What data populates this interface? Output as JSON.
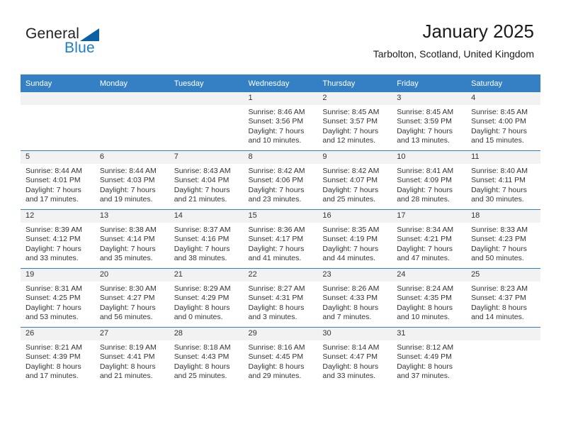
{
  "logo": {
    "word1": "General",
    "word2": "Blue",
    "accent_color": "#1d7ec8",
    "triangle_color": "#0b5fa5"
  },
  "header": {
    "title": "January 2025",
    "subtitle": "Tarbolton, Scotland, United Kingdom"
  },
  "theme": {
    "header_bg": "#3580c4",
    "daynum_bg": "#f2f2f2",
    "text": "#333333"
  },
  "weekday_headers": [
    "Sunday",
    "Monday",
    "Tuesday",
    "Wednesday",
    "Thursday",
    "Friday",
    "Saturday"
  ],
  "weeks": [
    [
      {
        "day": "",
        "empty": true,
        "sunrise": "",
        "sunset": "",
        "daylight1": "",
        "daylight2": ""
      },
      {
        "day": "",
        "empty": true,
        "sunrise": "",
        "sunset": "",
        "daylight1": "",
        "daylight2": ""
      },
      {
        "day": "",
        "empty": true,
        "sunrise": "",
        "sunset": "",
        "daylight1": "",
        "daylight2": ""
      },
      {
        "day": "1",
        "empty": false,
        "sunrise": "Sunrise: 8:46 AM",
        "sunset": "Sunset: 3:56 PM",
        "daylight1": "Daylight: 7 hours",
        "daylight2": "and 10 minutes."
      },
      {
        "day": "2",
        "empty": false,
        "sunrise": "Sunrise: 8:45 AM",
        "sunset": "Sunset: 3:57 PM",
        "daylight1": "Daylight: 7 hours",
        "daylight2": "and 12 minutes."
      },
      {
        "day": "3",
        "empty": false,
        "sunrise": "Sunrise: 8:45 AM",
        "sunset": "Sunset: 3:59 PM",
        "daylight1": "Daylight: 7 hours",
        "daylight2": "and 13 minutes."
      },
      {
        "day": "4",
        "empty": false,
        "sunrise": "Sunrise: 8:45 AM",
        "sunset": "Sunset: 4:00 PM",
        "daylight1": "Daylight: 7 hours",
        "daylight2": "and 15 minutes."
      }
    ],
    [
      {
        "day": "5",
        "empty": false,
        "sunrise": "Sunrise: 8:44 AM",
        "sunset": "Sunset: 4:01 PM",
        "daylight1": "Daylight: 7 hours",
        "daylight2": "and 17 minutes."
      },
      {
        "day": "6",
        "empty": false,
        "sunrise": "Sunrise: 8:44 AM",
        "sunset": "Sunset: 4:03 PM",
        "daylight1": "Daylight: 7 hours",
        "daylight2": "and 19 minutes."
      },
      {
        "day": "7",
        "empty": false,
        "sunrise": "Sunrise: 8:43 AM",
        "sunset": "Sunset: 4:04 PM",
        "daylight1": "Daylight: 7 hours",
        "daylight2": "and 21 minutes."
      },
      {
        "day": "8",
        "empty": false,
        "sunrise": "Sunrise: 8:42 AM",
        "sunset": "Sunset: 4:06 PM",
        "daylight1": "Daylight: 7 hours",
        "daylight2": "and 23 minutes."
      },
      {
        "day": "9",
        "empty": false,
        "sunrise": "Sunrise: 8:42 AM",
        "sunset": "Sunset: 4:07 PM",
        "daylight1": "Daylight: 7 hours",
        "daylight2": "and 25 minutes."
      },
      {
        "day": "10",
        "empty": false,
        "sunrise": "Sunrise: 8:41 AM",
        "sunset": "Sunset: 4:09 PM",
        "daylight1": "Daylight: 7 hours",
        "daylight2": "and 28 minutes."
      },
      {
        "day": "11",
        "empty": false,
        "sunrise": "Sunrise: 8:40 AM",
        "sunset": "Sunset: 4:11 PM",
        "daylight1": "Daylight: 7 hours",
        "daylight2": "and 30 minutes."
      }
    ],
    [
      {
        "day": "12",
        "empty": false,
        "sunrise": "Sunrise: 8:39 AM",
        "sunset": "Sunset: 4:12 PM",
        "daylight1": "Daylight: 7 hours",
        "daylight2": "and 33 minutes."
      },
      {
        "day": "13",
        "empty": false,
        "sunrise": "Sunrise: 8:38 AM",
        "sunset": "Sunset: 4:14 PM",
        "daylight1": "Daylight: 7 hours",
        "daylight2": "and 35 minutes."
      },
      {
        "day": "14",
        "empty": false,
        "sunrise": "Sunrise: 8:37 AM",
        "sunset": "Sunset: 4:16 PM",
        "daylight1": "Daylight: 7 hours",
        "daylight2": "and 38 minutes."
      },
      {
        "day": "15",
        "empty": false,
        "sunrise": "Sunrise: 8:36 AM",
        "sunset": "Sunset: 4:17 PM",
        "daylight1": "Daylight: 7 hours",
        "daylight2": "and 41 minutes."
      },
      {
        "day": "16",
        "empty": false,
        "sunrise": "Sunrise: 8:35 AM",
        "sunset": "Sunset: 4:19 PM",
        "daylight1": "Daylight: 7 hours",
        "daylight2": "and 44 minutes."
      },
      {
        "day": "17",
        "empty": false,
        "sunrise": "Sunrise: 8:34 AM",
        "sunset": "Sunset: 4:21 PM",
        "daylight1": "Daylight: 7 hours",
        "daylight2": "and 47 minutes."
      },
      {
        "day": "18",
        "empty": false,
        "sunrise": "Sunrise: 8:33 AM",
        "sunset": "Sunset: 4:23 PM",
        "daylight1": "Daylight: 7 hours",
        "daylight2": "and 50 minutes."
      }
    ],
    [
      {
        "day": "19",
        "empty": false,
        "sunrise": "Sunrise: 8:31 AM",
        "sunset": "Sunset: 4:25 PM",
        "daylight1": "Daylight: 7 hours",
        "daylight2": "and 53 minutes."
      },
      {
        "day": "20",
        "empty": false,
        "sunrise": "Sunrise: 8:30 AM",
        "sunset": "Sunset: 4:27 PM",
        "daylight1": "Daylight: 7 hours",
        "daylight2": "and 56 minutes."
      },
      {
        "day": "21",
        "empty": false,
        "sunrise": "Sunrise: 8:29 AM",
        "sunset": "Sunset: 4:29 PM",
        "daylight1": "Daylight: 8 hours",
        "daylight2": "and 0 minutes."
      },
      {
        "day": "22",
        "empty": false,
        "sunrise": "Sunrise: 8:27 AM",
        "sunset": "Sunset: 4:31 PM",
        "daylight1": "Daylight: 8 hours",
        "daylight2": "and 3 minutes."
      },
      {
        "day": "23",
        "empty": false,
        "sunrise": "Sunrise: 8:26 AM",
        "sunset": "Sunset: 4:33 PM",
        "daylight1": "Daylight: 8 hours",
        "daylight2": "and 7 minutes."
      },
      {
        "day": "24",
        "empty": false,
        "sunrise": "Sunrise: 8:24 AM",
        "sunset": "Sunset: 4:35 PM",
        "daylight1": "Daylight: 8 hours",
        "daylight2": "and 10 minutes."
      },
      {
        "day": "25",
        "empty": false,
        "sunrise": "Sunrise: 8:23 AM",
        "sunset": "Sunset: 4:37 PM",
        "daylight1": "Daylight: 8 hours",
        "daylight2": "and 14 minutes."
      }
    ],
    [
      {
        "day": "26",
        "empty": false,
        "sunrise": "Sunrise: 8:21 AM",
        "sunset": "Sunset: 4:39 PM",
        "daylight1": "Daylight: 8 hours",
        "daylight2": "and 17 minutes."
      },
      {
        "day": "27",
        "empty": false,
        "sunrise": "Sunrise: 8:19 AM",
        "sunset": "Sunset: 4:41 PM",
        "daylight1": "Daylight: 8 hours",
        "daylight2": "and 21 minutes."
      },
      {
        "day": "28",
        "empty": false,
        "sunrise": "Sunrise: 8:18 AM",
        "sunset": "Sunset: 4:43 PM",
        "daylight1": "Daylight: 8 hours",
        "daylight2": "and 25 minutes."
      },
      {
        "day": "29",
        "empty": false,
        "sunrise": "Sunrise: 8:16 AM",
        "sunset": "Sunset: 4:45 PM",
        "daylight1": "Daylight: 8 hours",
        "daylight2": "and 29 minutes."
      },
      {
        "day": "30",
        "empty": false,
        "sunrise": "Sunrise: 8:14 AM",
        "sunset": "Sunset: 4:47 PM",
        "daylight1": "Daylight: 8 hours",
        "daylight2": "and 33 minutes."
      },
      {
        "day": "31",
        "empty": false,
        "sunrise": "Sunrise: 8:12 AM",
        "sunset": "Sunset: 4:49 PM",
        "daylight1": "Daylight: 8 hours",
        "daylight2": "and 37 minutes."
      },
      {
        "day": "",
        "empty": true,
        "sunrise": "",
        "sunset": "",
        "daylight1": "",
        "daylight2": ""
      }
    ]
  ]
}
